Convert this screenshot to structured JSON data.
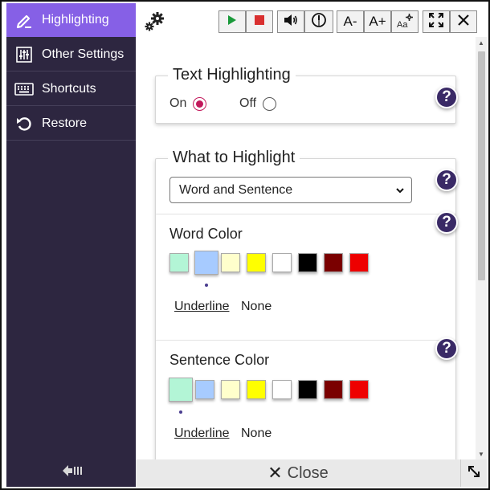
{
  "sidebar": {
    "items": [
      {
        "label": "Highlighting",
        "icon": "pen-icon",
        "active": true
      },
      {
        "label": "Other Settings",
        "icon": "sliders-icon",
        "active": false
      },
      {
        "label": "Shortcuts",
        "icon": "keyboard-icon",
        "active": false
      },
      {
        "label": "Restore",
        "icon": "restore-icon",
        "active": false
      }
    ],
    "collapse_icon": "collapse-left-icon",
    "active_color": "#8660e6",
    "background_color": "#2d2640"
  },
  "toolbar": {
    "buttons": [
      {
        "name": "play-button",
        "icon": "play-icon",
        "color": "#1a9a3a"
      },
      {
        "name": "stop-button",
        "icon": "stop-icon",
        "color": "#d93030"
      },
      {
        "name": "volume-button",
        "icon": "speaker-icon"
      },
      {
        "name": "speed-button",
        "icon": "speedometer-icon"
      },
      {
        "name": "decrease-font-button",
        "label": "A-"
      },
      {
        "name": "increase-font-button",
        "label": "A+"
      },
      {
        "name": "text-settings-button",
        "label": "Aa"
      },
      {
        "name": "fullscreen-button",
        "icon": "expand-icon"
      },
      {
        "name": "close-button",
        "icon": "close-icon"
      }
    ]
  },
  "text_highlighting": {
    "title": "Text Highlighting",
    "on_label": "On",
    "off_label": "Off",
    "selected": "On"
  },
  "what_to_highlight": {
    "title": "What to Highlight",
    "dropdown_value": "Word and Sentence"
  },
  "word_color": {
    "title": "Word Color",
    "colors": [
      "#b3f5d6",
      "#a7cbff",
      "#ffffcc",
      "#ffff00",
      "#ffffff",
      "#000000",
      "#7a0000",
      "#ee0000"
    ],
    "selected_index": 1,
    "underline_label": "Underline",
    "none_label": "None"
  },
  "sentence_color": {
    "title": "Sentence Color",
    "colors": [
      "#b3f5d6",
      "#a7cbff",
      "#ffffcc",
      "#ffff00",
      "#ffffff",
      "#000000",
      "#7a0000",
      "#ee0000"
    ],
    "selected_index": 0,
    "underline_label": "Underline",
    "none_label": "None"
  },
  "help_label": "?",
  "close_bar": {
    "label": "Close"
  },
  "accent_color": "#3a2a66",
  "radio_color": "#c2185b"
}
